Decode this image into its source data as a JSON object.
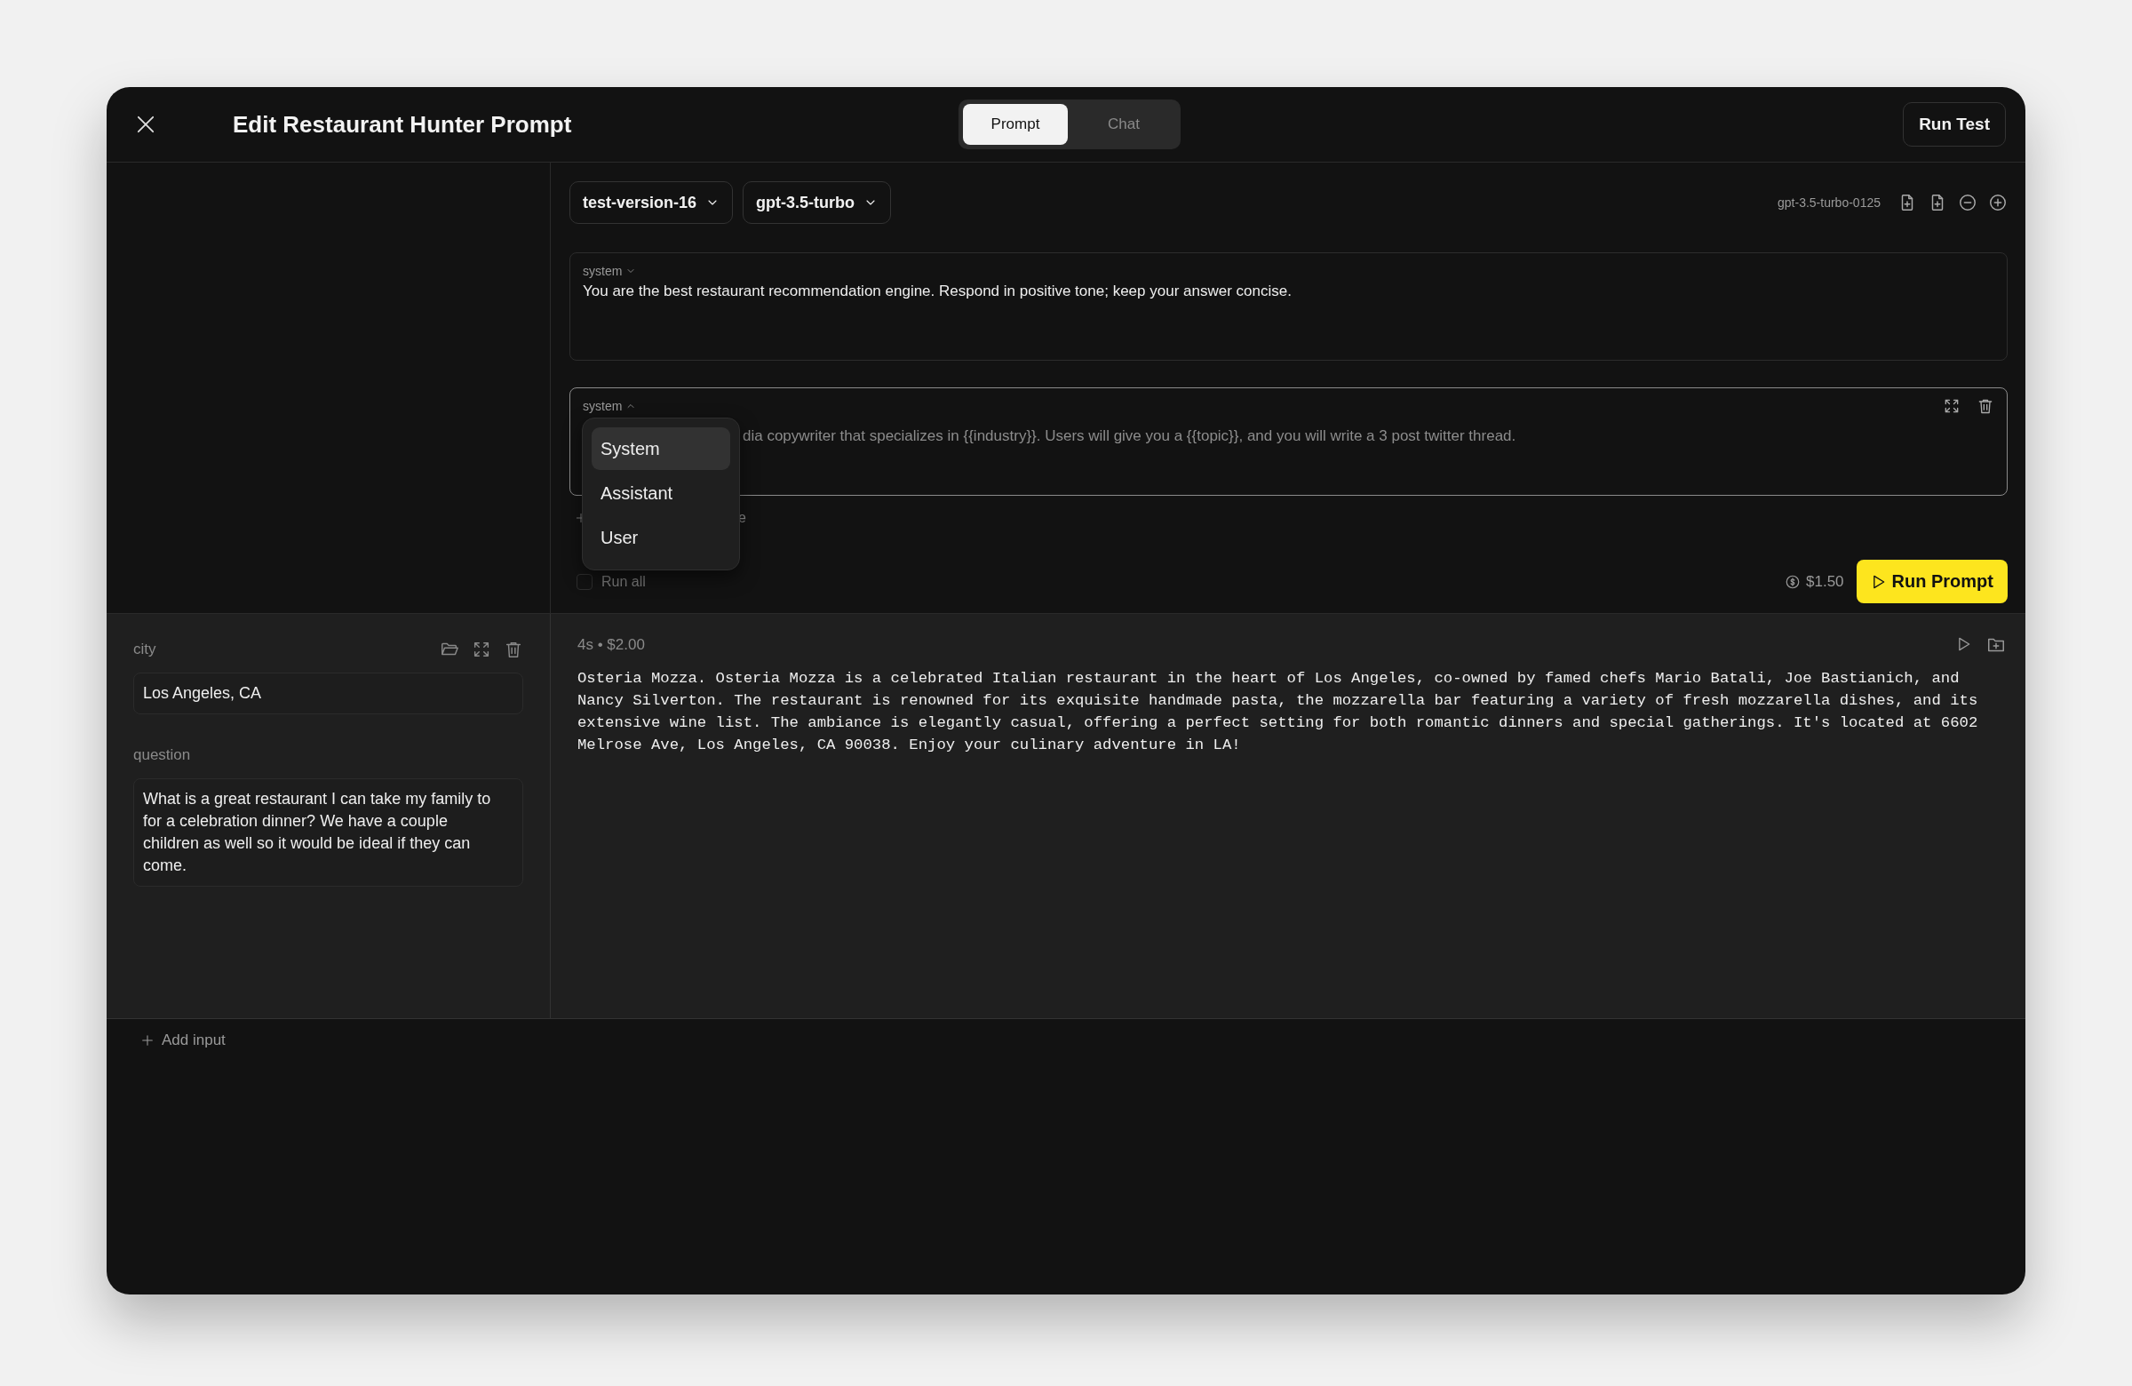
{
  "header": {
    "title": "Edit Restaurant Hunter Prompt",
    "tabs": [
      {
        "label": "Prompt",
        "selected": true
      },
      {
        "label": "Chat",
        "selected": false
      }
    ],
    "run_test": "Run Test"
  },
  "editor": {
    "version": "test-version-16",
    "model": "gpt-3.5-turbo",
    "model_id": "gpt-3.5-turbo-0125",
    "messages": [
      {
        "role": "system",
        "text": "You are the best restaurant recommendation engine. Respond in positive tone; keep your answer concise.",
        "menu_open": false
      },
      {
        "role": "system",
        "text": "dia copywriter that specializes in {{industry}}. Users will give you a {{topic}}, and you will write a 3 post twitter thread.",
        "menu_open": true,
        "role_menu": [
          {
            "label": "System",
            "selected": true
          },
          {
            "label": "Assistant",
            "selected": false
          },
          {
            "label": "User",
            "selected": false
          }
        ]
      }
    ],
    "add_message": "e",
    "run_all": "Run all",
    "run_all_checked": false,
    "cost": "$1.50",
    "run_prompt": "Run Prompt"
  },
  "inputs": [
    {
      "name": "city",
      "value": "Los Angeles, CA"
    },
    {
      "name": "question",
      "value": "What is a great restaurant I can take my family to for a celebration dinner? We have a couple children as well so it would be ideal if they can come."
    }
  ],
  "add_input": "Add input",
  "output": {
    "meta": "4s • $2.00",
    "text": "Osteria Mozza. Osteria Mozza is a celebrated Italian restaurant in the heart of Los Angeles, co-owned by famed chefs Mario Batali, Joe Bastianich, and Nancy Silverton. The restaurant is renowned for its exquisite handmade pasta, the mozzarella bar featuring a variety of fresh mozzarella dishes, and its extensive wine list. The ambiance is elegantly casual, offering a perfect setting for both romantic dinners and special gatherings. It's located at 6602 Melrose Ave, Los Angeles, CA 90038. Enjoy your culinary adventure in LA!"
  }
}
